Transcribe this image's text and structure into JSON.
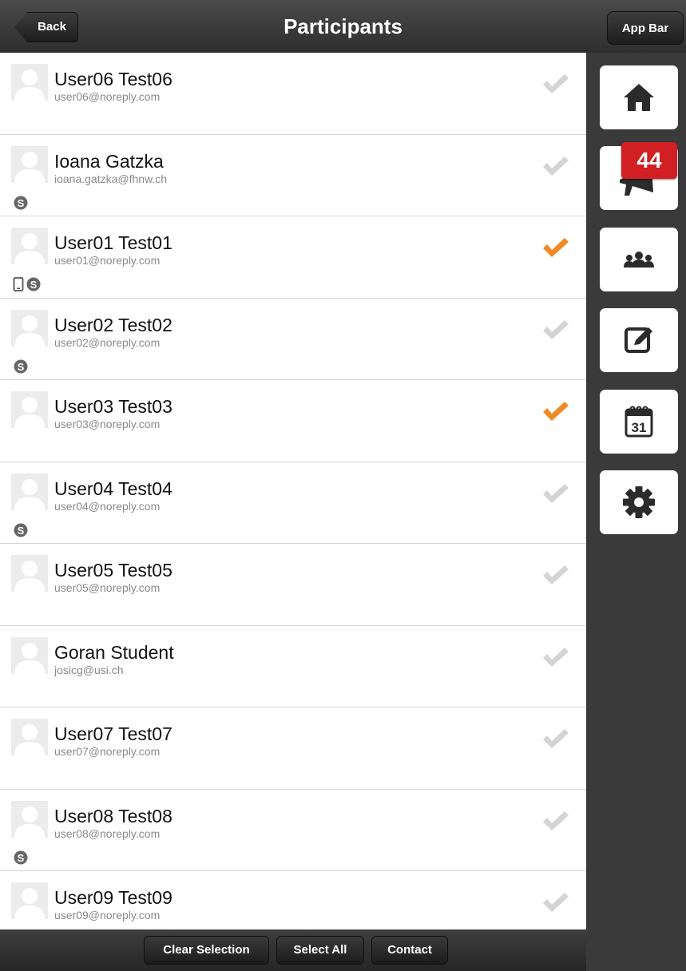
{
  "header": {
    "back_label": "Back",
    "title": "Participants",
    "app_bar_label": "App Bar"
  },
  "participants": [
    {
      "name": "User06 Test06",
      "email": "user06@noreply.com",
      "selected": false,
      "icons": []
    },
    {
      "name": "Ioana Gatzka",
      "email": "ioana.gatzka@fhnw.ch",
      "selected": false,
      "icons": [
        "skype-icon"
      ]
    },
    {
      "name": "User01 Test01",
      "email": "user01@noreply.com",
      "selected": true,
      "icons": [
        "mobile-icon",
        "skype-icon"
      ]
    },
    {
      "name": "User02 Test02",
      "email": "user02@noreply.com",
      "selected": false,
      "icons": [
        "skype-icon"
      ]
    },
    {
      "name": "User03 Test03",
      "email": "user03@noreply.com",
      "selected": true,
      "icons": []
    },
    {
      "name": "User04 Test04",
      "email": "user04@noreply.com",
      "selected": false,
      "icons": [
        "skype-icon"
      ]
    },
    {
      "name": "User05 Test05",
      "email": "user05@noreply.com",
      "selected": false,
      "icons": []
    },
    {
      "name": "Goran Student",
      "email": "josicg@usi.ch",
      "selected": false,
      "icons": []
    },
    {
      "name": "User07 Test07",
      "email": "user07@noreply.com",
      "selected": false,
      "icons": []
    },
    {
      "name": "User08 Test08",
      "email": "user08@noreply.com",
      "selected": false,
      "icons": [
        "skype-icon"
      ]
    },
    {
      "name": "User09 Test09",
      "email": "user09@noreply.com",
      "selected": false,
      "icons": []
    }
  ],
  "footer": {
    "clear_label": "Clear Selection",
    "select_all_label": "Select All",
    "contact_label": "Contact"
  },
  "sidebar": {
    "items": [
      {
        "icon": "home-icon"
      },
      {
        "icon": "megaphone-icon",
        "badge": "44"
      },
      {
        "icon": "group-icon"
      },
      {
        "icon": "edit-icon"
      },
      {
        "icon": "calendar-icon",
        "label": "31"
      },
      {
        "icon": "gear-icon"
      }
    ]
  },
  "colors": {
    "check_selected": "#f08a24",
    "check_unselected": "#d4d4d4",
    "badge": "#d11f24"
  }
}
